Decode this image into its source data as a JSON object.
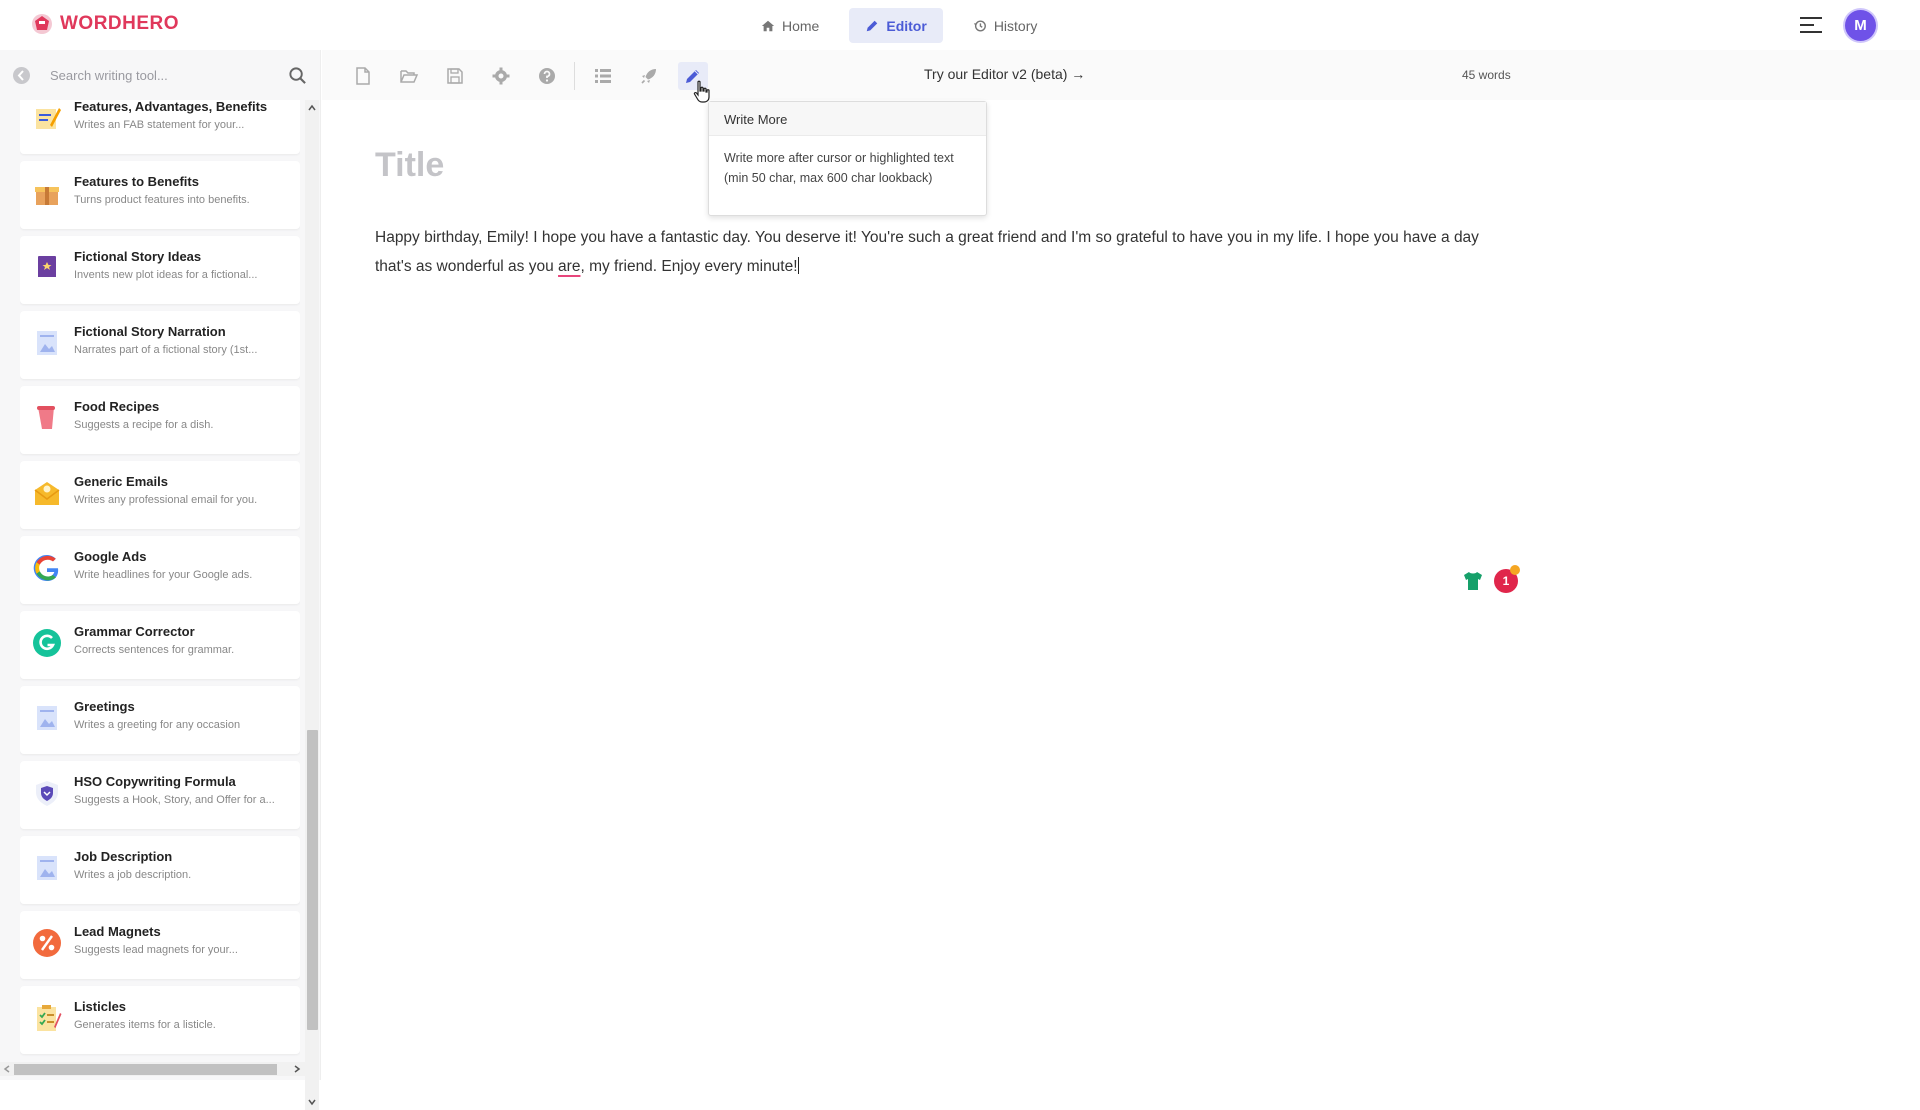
{
  "app": {
    "logo_text": "WORDHERO",
    "brand_color": "#e0385b",
    "accent_color": "#4b5bd6"
  },
  "nav": {
    "tabs": [
      {
        "label": "Home",
        "icon": "home-icon",
        "active": false
      },
      {
        "label": "Editor",
        "icon": "pencil-icon",
        "active": true
      },
      {
        "label": "History",
        "icon": "history-icon",
        "active": false
      }
    ],
    "avatar_initial": "M"
  },
  "sidebar": {
    "search_placeholder": "Search writing tool...",
    "tools": [
      {
        "name": "Features, Advantages, Benefits",
        "desc": "Writes an FAB statement for your...",
        "icon": "fab-notepad-icon"
      },
      {
        "name": "Features to Benefits",
        "desc": "Turns product features into benefits.",
        "icon": "gift-box-icon"
      },
      {
        "name": "Fictional Story Ideas",
        "desc": "Invents new plot ideas for a fictional...",
        "icon": "book-icon"
      },
      {
        "name": "Fictional Story Narration",
        "desc": "Narrates part of a fictional story (1st...",
        "icon": "document-image-icon"
      },
      {
        "name": "Food Recipes",
        "desc": "Suggests a recipe for a dish.",
        "icon": "recipe-scroll-icon"
      },
      {
        "name": "Generic Emails",
        "desc": "Writes any professional email for you.",
        "icon": "envelope-icon"
      },
      {
        "name": "Google Ads",
        "desc": "Write headlines for your Google ads.",
        "icon": "google-icon"
      },
      {
        "name": "Grammar Corrector",
        "desc": "Corrects sentences for grammar.",
        "icon": "grammarly-icon"
      },
      {
        "name": "Greetings",
        "desc": "Writes a greeting for any occasion",
        "icon": "document-image-icon"
      },
      {
        "name": "HSO Copywriting Formula",
        "desc": "Suggests a Hook, Story, and Offer for a...",
        "icon": "shield-icon"
      },
      {
        "name": "Job Description",
        "desc": "Writes a job description.",
        "icon": "document-image-icon"
      },
      {
        "name": "Lead Magnets",
        "desc": "Suggests lead magnets for your...",
        "icon": "percent-icon"
      },
      {
        "name": "Listicles",
        "desc": "Generates items for a listicle.",
        "icon": "checklist-icon"
      }
    ]
  },
  "toolbar": {
    "beta_link": "Try our Editor v2 (beta) →",
    "word_count": "45 words"
  },
  "tooltip": {
    "title": "Write More",
    "body": "Write more after cursor or highlighted text (min 50 char, max 600 char lookback)"
  },
  "editor": {
    "title_placeholder": "Title",
    "body_before": "Happy birthday, Emily! I hope you have a fantastic day. You deserve it! You're such a great friend and I'm so grateful to have you in my life. I hope you have a day that's as wonderful as you ",
    "body_misspelled": "are",
    "body_after": ", my friend. Enjoy every minute!"
  },
  "notifications": {
    "count": "1"
  }
}
